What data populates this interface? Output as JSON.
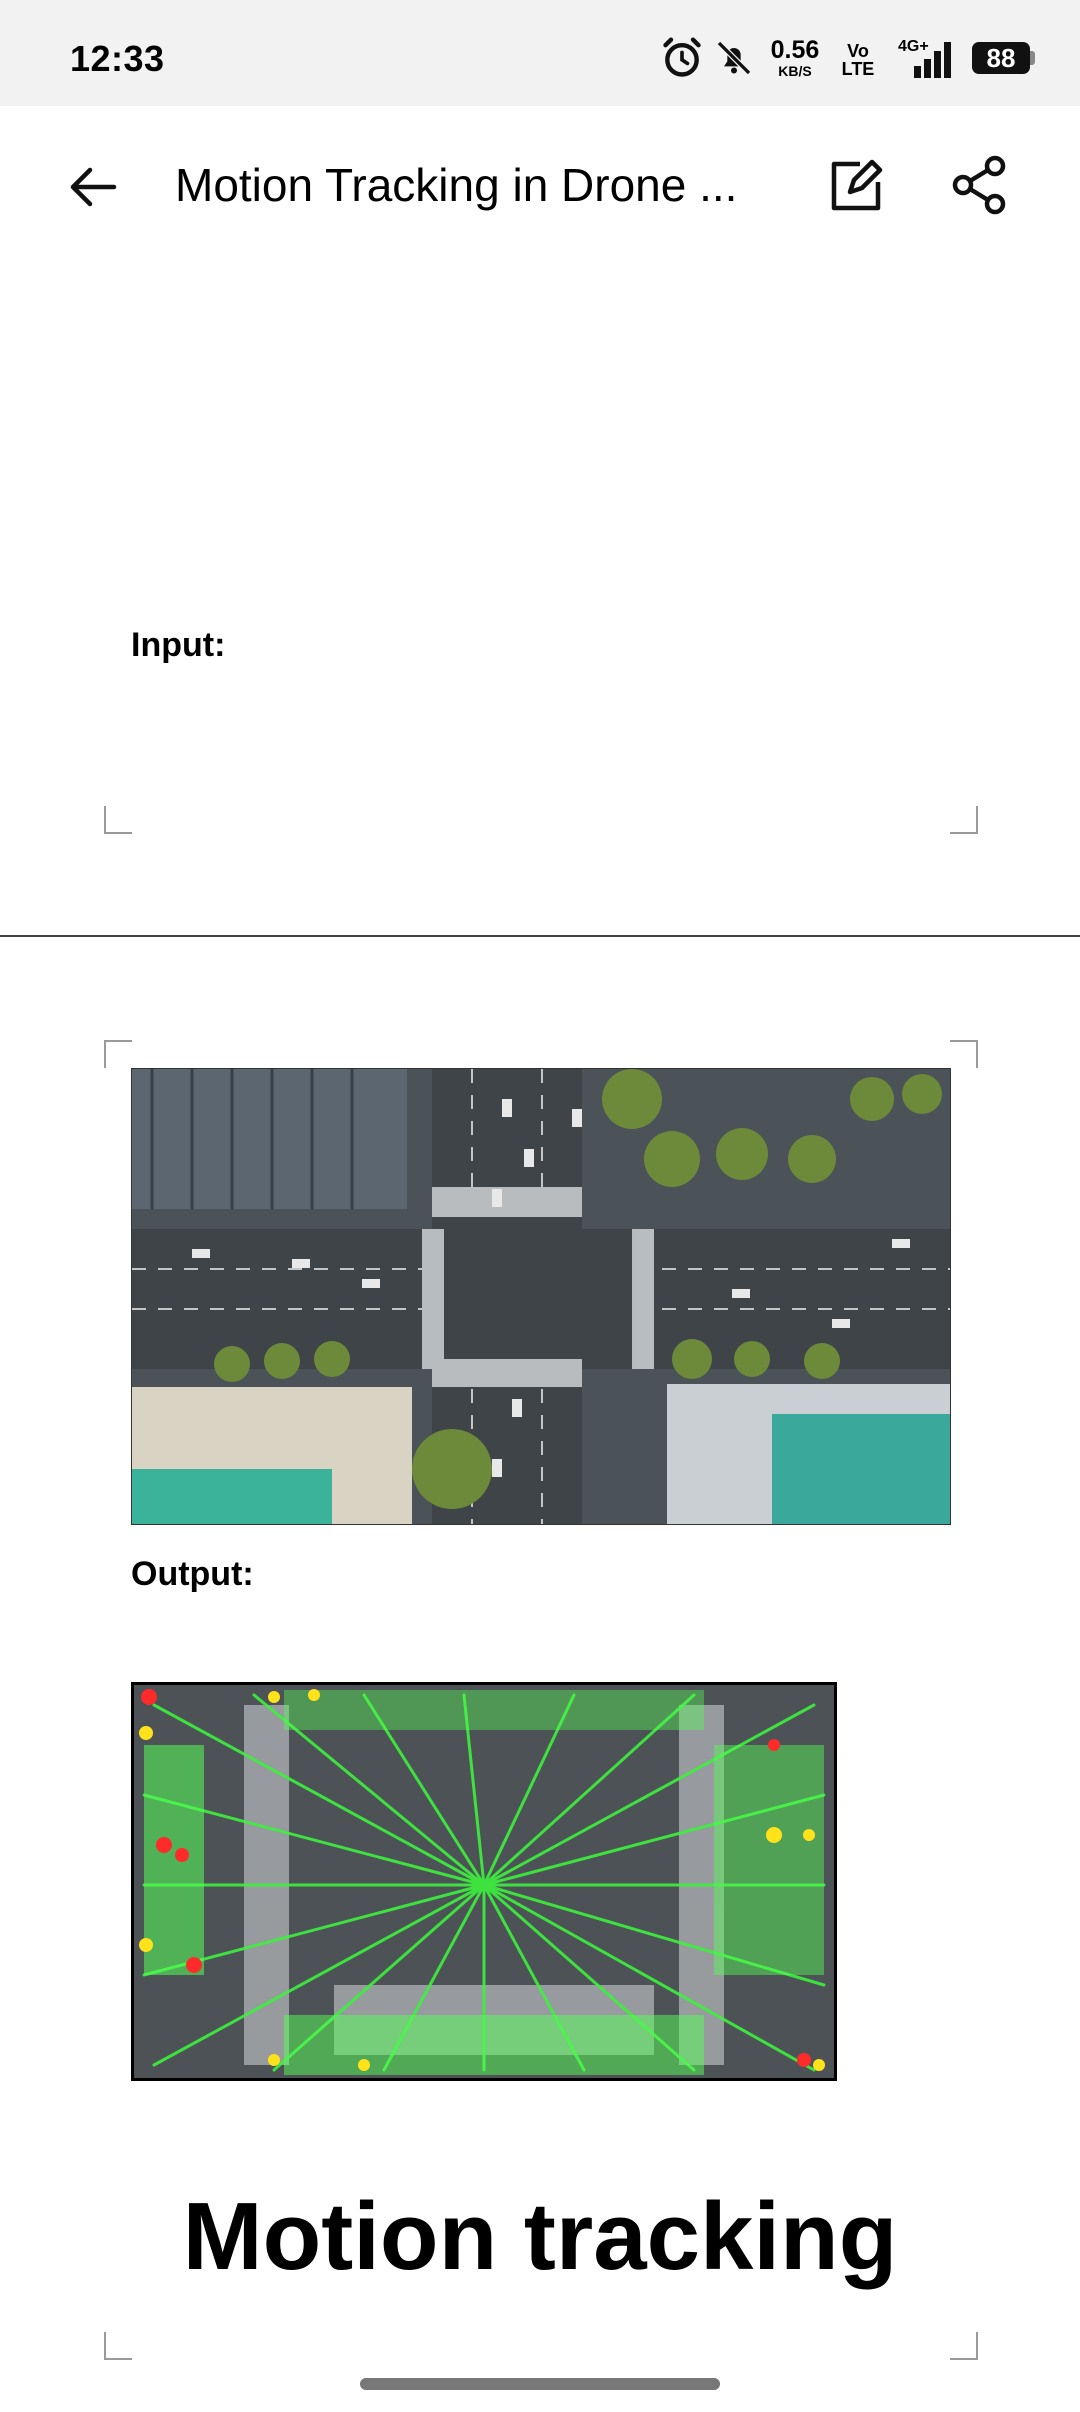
{
  "status_bar": {
    "time": "12:33",
    "net_speed_value": "0.56",
    "net_speed_unit": "KB/S",
    "volte_line1": "Vo",
    "volte_line2": "LTE",
    "network": "4G+",
    "battery": "88"
  },
  "app_bar": {
    "title": "Motion Tracking in Drone ..."
  },
  "document": {
    "input_label": "Input:",
    "output_label": "Output:",
    "heading": "Motion tracking"
  }
}
